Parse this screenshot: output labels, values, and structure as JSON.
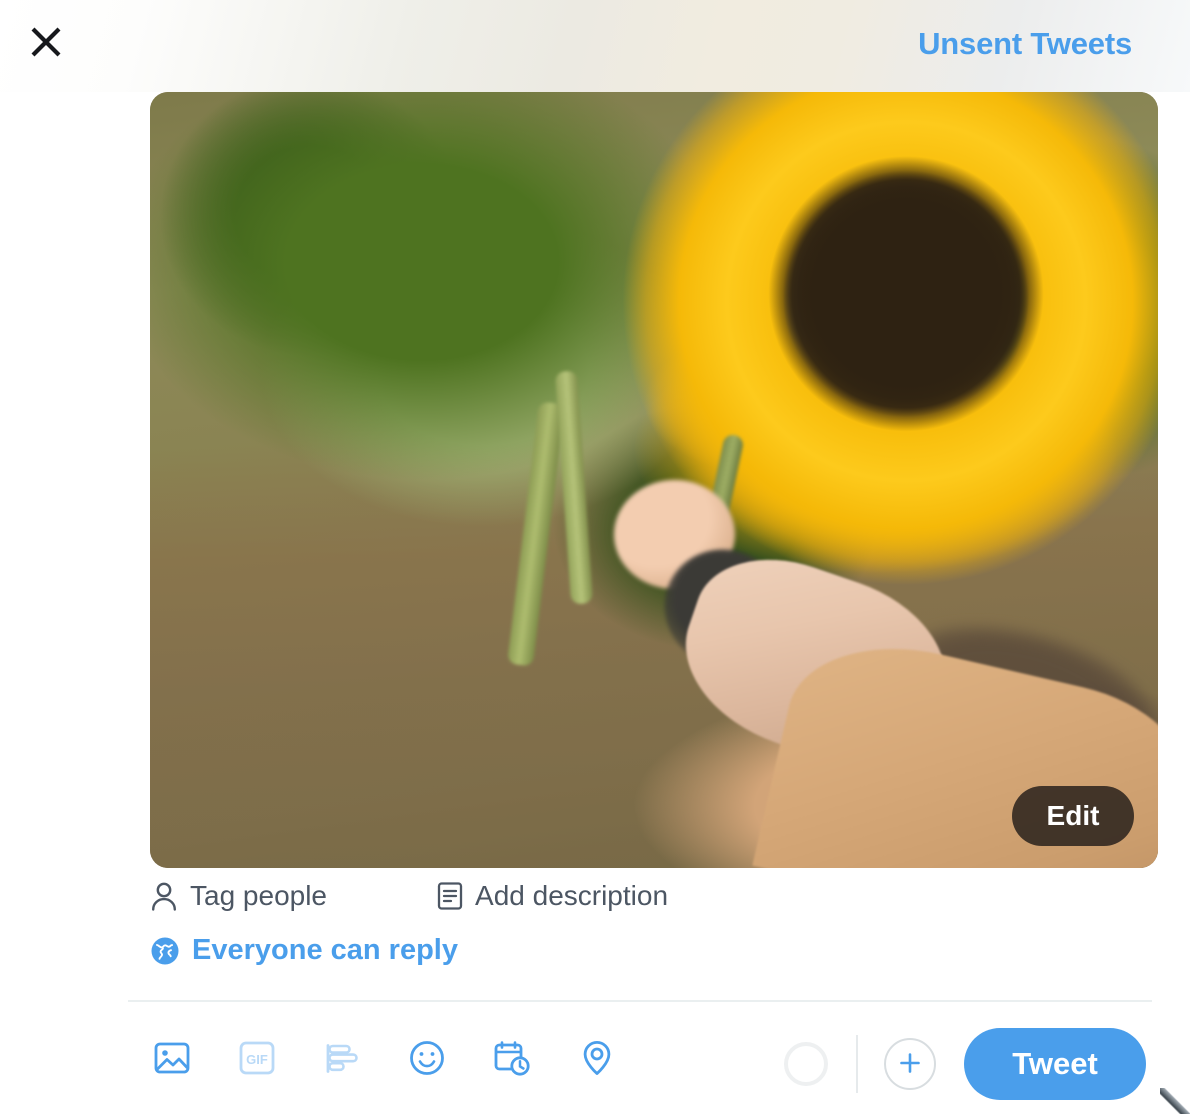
{
  "header": {
    "close_icon": "close-icon",
    "unsent_tweets_label": "Unsent Tweets"
  },
  "media": {
    "edit_label": "Edit",
    "alt_description": "A hand in a tan fleece coat holding a bouquet of sunflowers in a field",
    "edit_icon": "edit-button"
  },
  "media_actions": [
    {
      "icon": "person-icon",
      "label": "Tag people"
    },
    {
      "icon": "description-icon",
      "label": "Add description"
    }
  ],
  "reply_audience": {
    "icon": "globe-icon",
    "label": "Everyone can reply"
  },
  "toolbar": {
    "items": [
      {
        "icon": "image-icon",
        "label": "Media",
        "dim": false
      },
      {
        "icon": "gif-icon",
        "label": "GIF",
        "dim": true
      },
      {
        "icon": "poll-icon",
        "label": "Poll",
        "dim": true
      },
      {
        "icon": "emoji-icon",
        "label": "Emoji",
        "dim": false
      },
      {
        "icon": "schedule-icon",
        "label": "Schedule",
        "dim": false
      },
      {
        "icon": "location-icon",
        "label": "Location",
        "dim": false
      }
    ],
    "gif_text": "GIF",
    "char_count_icon": "character-count-ring",
    "add_icon": "plus-icon",
    "tweet_label": "Tweet"
  },
  "colors": {
    "accent": "#4a9eeb",
    "text_secondary": "#4c5663",
    "divider": "#eaeff0",
    "edit_overlay": "#221c18"
  }
}
